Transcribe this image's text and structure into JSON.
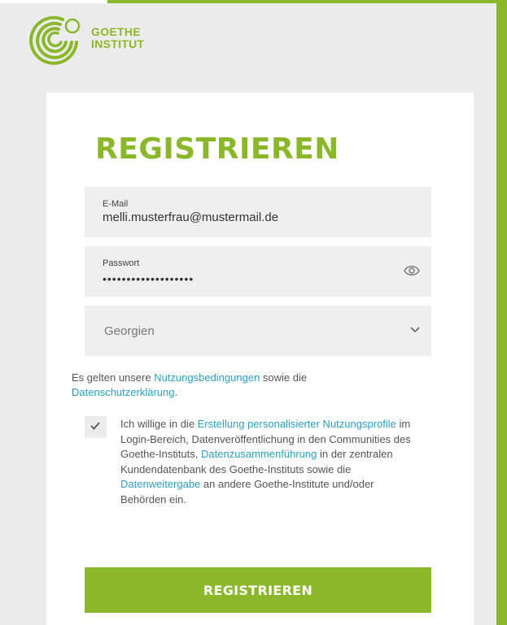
{
  "brand": {
    "line1": "GOETHE",
    "line2": "INSTITUT",
    "color": "#8ab82a"
  },
  "form": {
    "title": "REGISTRIEREN",
    "email": {
      "label": "E-Mail",
      "value": "melli.musterfrau@mustermail.de"
    },
    "password": {
      "label": "Passwort",
      "value": "•••••••••••••••••••",
      "icon": "eye-icon"
    },
    "country": {
      "value": "Georgien",
      "icon": "chevron-down-icon"
    },
    "terms": {
      "prefix": "Es gelten unsere ",
      "link1": "Nutzungsbedingungen",
      "middle": " sowie die ",
      "link2": "Datenschutzerklärung",
      "suffix": "."
    },
    "consent": {
      "checked": true,
      "t1": "Ich willige in die ",
      "l1": "Erstellung personalisierter Nutzungsprofile",
      "t2": " im Login-Bereich, Datenveröffentlichung in den Communities des Goethe-Instituts, ",
      "l2": "Datenzusammenführung",
      "t3": " in der zentralen Kundendatenbank des Goethe-Instituts sowie die ",
      "l3": "Datenweitergabe",
      "t4": " an andere Goethe-Institute und/oder Behörden ein."
    },
    "submit_label": "REGISTRIEREN"
  }
}
